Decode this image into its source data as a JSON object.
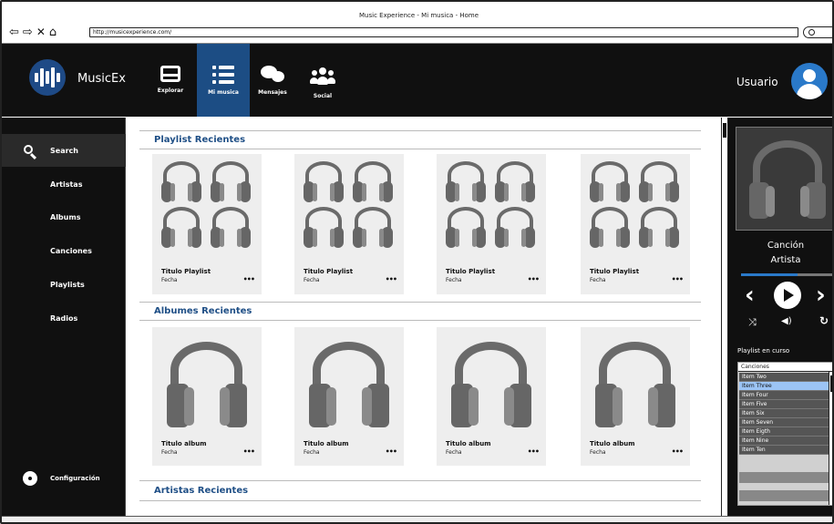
{
  "window": {
    "title": "Music Experience - Mi musica - Home",
    "url": "http://musicexperience.com/"
  },
  "nav_icons": {
    "back": "back-arrow-icon",
    "forward": "forward-arrow-icon",
    "close": "close-icon",
    "home": "home-icon"
  },
  "brand": {
    "name": "MusicEx"
  },
  "top_nav": [
    {
      "label": "Explorar",
      "icon": "inbox-icon"
    },
    {
      "label": "Mi musica",
      "icon": "list-icon",
      "active": true
    },
    {
      "label": "Mensajes",
      "icon": "chat-icon"
    },
    {
      "label": "Social",
      "icon": "group-icon"
    }
  ],
  "user": {
    "name": "Usuario"
  },
  "sidebar": {
    "search": "Search",
    "items": [
      "Artistas",
      "Albums",
      "Canciones",
      "Playlists",
      "Radios"
    ],
    "settings": "Configuración"
  },
  "sections": {
    "playlists": {
      "title": "Playlist Recientes",
      "cards": [
        {
          "title": "Titulo Playlist",
          "date": "Fecha"
        },
        {
          "title": "Titulo Playlist",
          "date": "Fecha"
        },
        {
          "title": "Titulo Playlist",
          "date": "Fecha"
        },
        {
          "title": "Titulo Playlist",
          "date": "Fecha"
        }
      ]
    },
    "albums": {
      "title": "Albumes Recientes",
      "cards": [
        {
          "title": "Titulo album",
          "date": "Fecha"
        },
        {
          "title": "Titulo album",
          "date": "Fecha"
        },
        {
          "title": "Titulo album",
          "date": "Fecha"
        },
        {
          "title": "Titulo album",
          "date": "Fecha"
        }
      ]
    },
    "artists": {
      "title": "Artistas Recientes"
    }
  },
  "more_label": "•••",
  "player": {
    "song": "Canción",
    "artist": "Artista",
    "progress": 0.6,
    "playlist_label": "Playlist en curso",
    "playlist_header": "Canciones",
    "playlist_items": [
      "Item Two",
      "Item Three",
      "Item Four",
      "Item Five",
      "Item Six",
      "Item Seven",
      "Item Eigth",
      "Item Nine",
      "Item Ten"
    ],
    "selected_item": "Item Three"
  },
  "colors": {
    "accent": "#1c4d84",
    "header_bg": "#101010",
    "selected": "#9cc4f5"
  }
}
